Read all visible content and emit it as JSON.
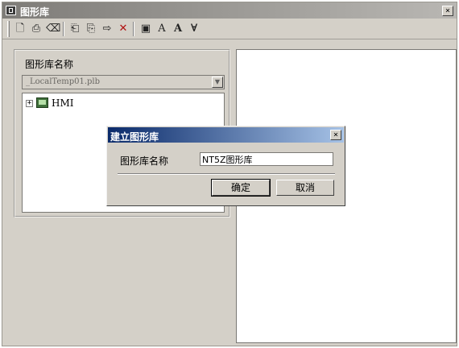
{
  "window": {
    "title": "图形库",
    "close_glyph": "×"
  },
  "toolbar": {
    "buttons": [
      {
        "name": "new-library-icon",
        "glyph": "🗋"
      },
      {
        "name": "open-library-icon",
        "glyph": "⎙"
      },
      {
        "name": "delete-library-icon",
        "glyph": "⌫"
      },
      {
        "name": "import-icon",
        "glyph": "⎗"
      },
      {
        "name": "export-icon",
        "glyph": "⎘"
      },
      {
        "name": "move-right-icon",
        "glyph": "⇨"
      },
      {
        "name": "delete-icon",
        "glyph": "✕"
      },
      {
        "name": "image-icon",
        "glyph": "▣"
      },
      {
        "name": "font-a-icon",
        "glyph": "A"
      },
      {
        "name": "font-a-bold-icon",
        "glyph": "A"
      },
      {
        "name": "font-v-icon",
        "glyph": "∀"
      }
    ]
  },
  "library_panel": {
    "label": "图形库名称",
    "selected_library": "_LocalTemp01.plb",
    "tree": {
      "expander": "⊞",
      "root_label": "HMI"
    }
  },
  "dialog": {
    "title": "建立图形库",
    "close_glyph": "×",
    "name_label": "图形库名称",
    "name_value": "NT5Z图形库",
    "ok_label": "确定",
    "cancel_label": "取消"
  },
  "colors": {
    "window_bg": "#d4d0c8",
    "dialog_title_start": "#0a2a6a",
    "dialog_title_end": "#a6c2e6"
  }
}
